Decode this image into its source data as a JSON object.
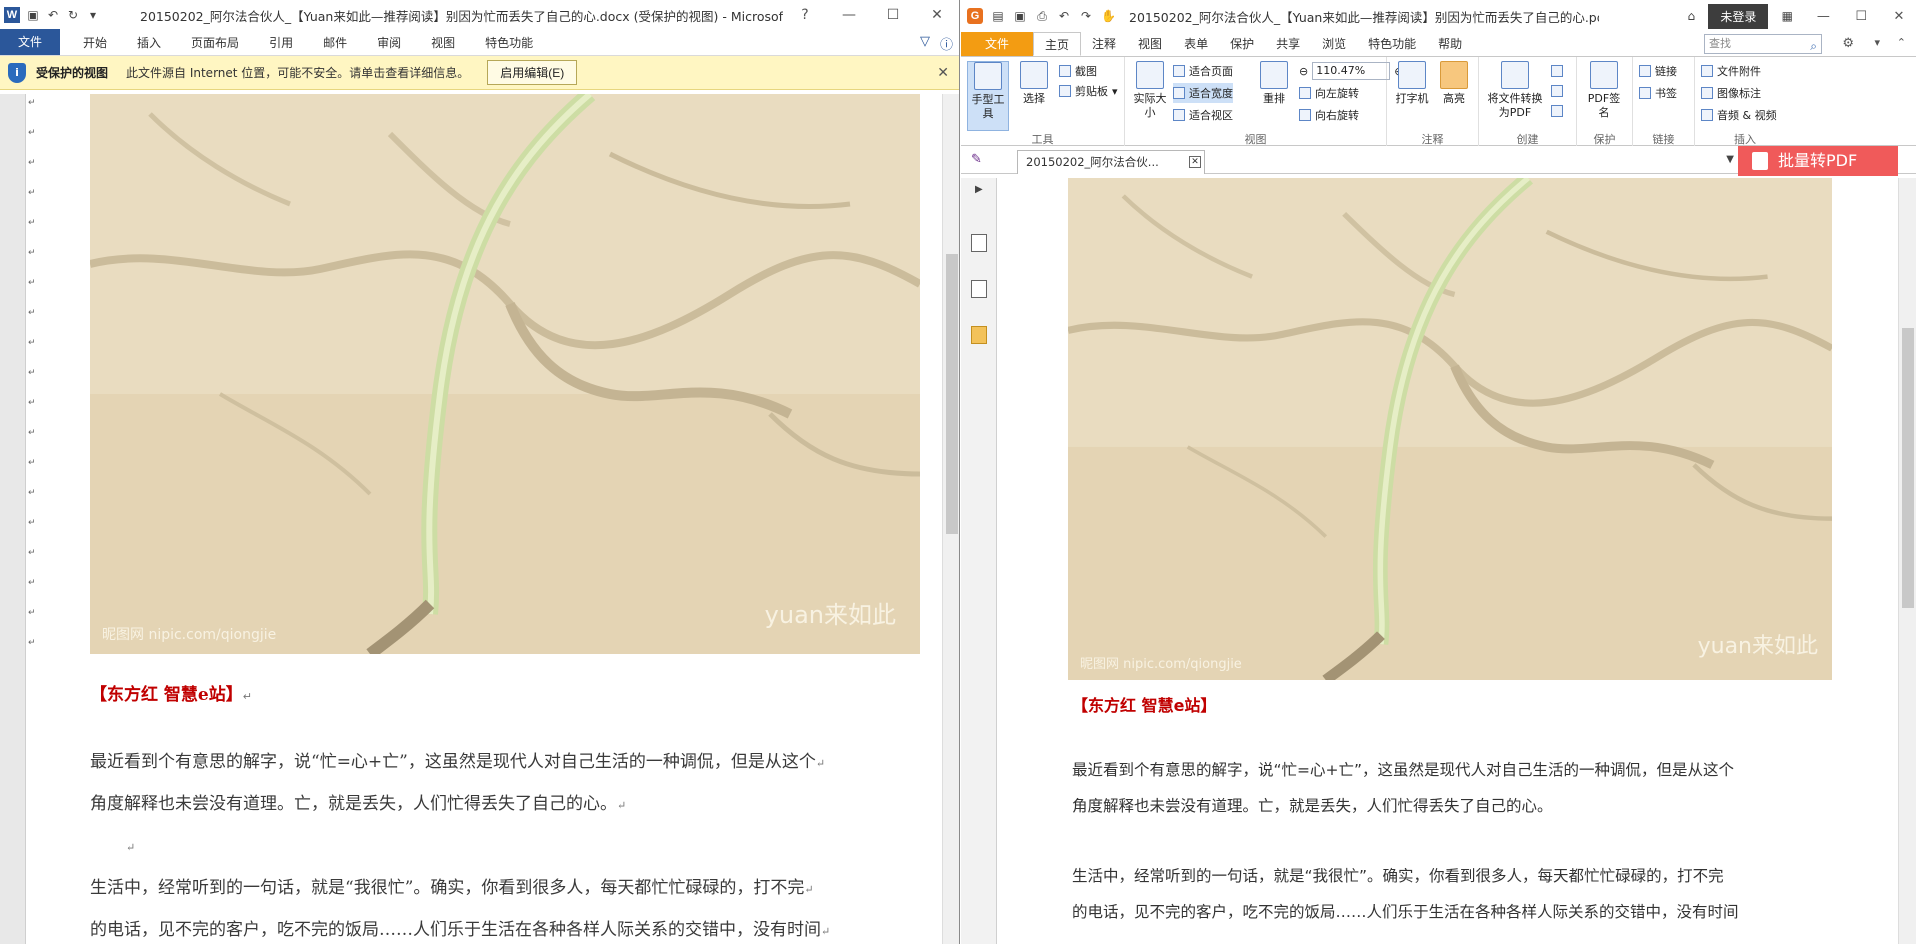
{
  "word": {
    "title": "20150202_阿尔法合伙人_【Yuan来如此—推荐阅读】别因为忙而丢失了自己的心.docx (受保护的视图) - Microsoft Word",
    "tabs": [
      "文件",
      "开始",
      "插入",
      "页面布局",
      "引用",
      "邮件",
      "审阅",
      "视图",
      "特色功能"
    ],
    "protected_bar": {
      "title": "受保护的视图",
      "message": "此文件源自 Internet 位置，可能不安全。请单击查看详细信息。",
      "button": "启用编辑(E)"
    },
    "image_watermark_left": "昵图网 nipic.com/qiongjie",
    "image_watermark_right": "yuan来如此",
    "heading": "【东方红 智慧e站】",
    "para1_line1": "最近看到个有意思的解字，说“忙=心+亡”，这虽然是现代人对自己生活的一种调侃，但是从这个",
    "para1_line2": "角度解释也未尝没有道理。亡，就是丢失，人们忙得丢失了自己的心。",
    "para2_line1": "生活中，经常听到的一句话，就是“我很忙”。确实，你看到很多人，每天都忙忙碌碌的，打不完",
    "para2_line2": "的电话，见不完的客户，吃不完的饭局……人们乐于生活在各种各样人际关系的交错中，没有时间"
  },
  "pdf": {
    "title": "20150202_阿尔法合伙人_【Yuan来如此—推荐阅读】别因为忙而丢失了自己的心.pd...",
    "login": "未登录",
    "tabs": [
      "文件",
      "主页",
      "注释",
      "视图",
      "表单",
      "保护",
      "共享",
      "浏览",
      "特色功能",
      "帮助"
    ],
    "search_placeholder": "查找",
    "ribbon": {
      "hand_tool": "手型工具",
      "select": "选择",
      "screenshot": "截图",
      "clipboard": "剪贴板",
      "group_tools": "工具",
      "actual_size": "实际大小",
      "fit_page": "适合页面",
      "fit_width": "适合宽度",
      "fit_visible": "适合视区",
      "reflow": "重排",
      "zoom_value": "110.47%",
      "rotate_left": "向左旋转",
      "rotate_right": "向右旋转",
      "group_view": "视图",
      "typewriter": "打字机",
      "highlight": "高亮",
      "group_comment": "注释",
      "convert": "将文件转换为PDF",
      "group_create": "创建",
      "sign": "PDF签名",
      "group_protect": "保护",
      "link": "链接",
      "bookmark": "书签",
      "group_link": "链接",
      "attachment": "文件附件",
      "image_note": "图像标注",
      "audio_video": "音频 & 视频",
      "group_insert": "插入"
    },
    "doc_tab": "20150202_阿尔法合伙...",
    "batch_button": "批量转PDF",
    "image_watermark_left": "昵图网 nipic.com/qiongjie",
    "image_watermark_right": "yuan来如此",
    "heading": "【东方红 智慧e站】",
    "para1_line1": "最近看到个有意思的解字，说“忙=心+亡”，这虽然是现代人对自己生活的一种调侃，但是从这个",
    "para1_line2": "角度解释也未尝没有道理。亡，就是丢失，人们忙得丢失了自己的心。",
    "para2_line1": "生活中，经常听到的一句话，就是“我很忙”。确实，你看到很多人，每天都忙忙碌碌的，打不完",
    "para2_line2": "的电话，见不完的客户，吃不完的饭局……人们乐于生活在各种各样人际关系的交错中，没有时间"
  },
  "colors": {
    "word_blue": "#2b579a",
    "foxit_orange": "#f39c12",
    "heading_red": "#c00000",
    "batch_red": "#f05a5a"
  }
}
